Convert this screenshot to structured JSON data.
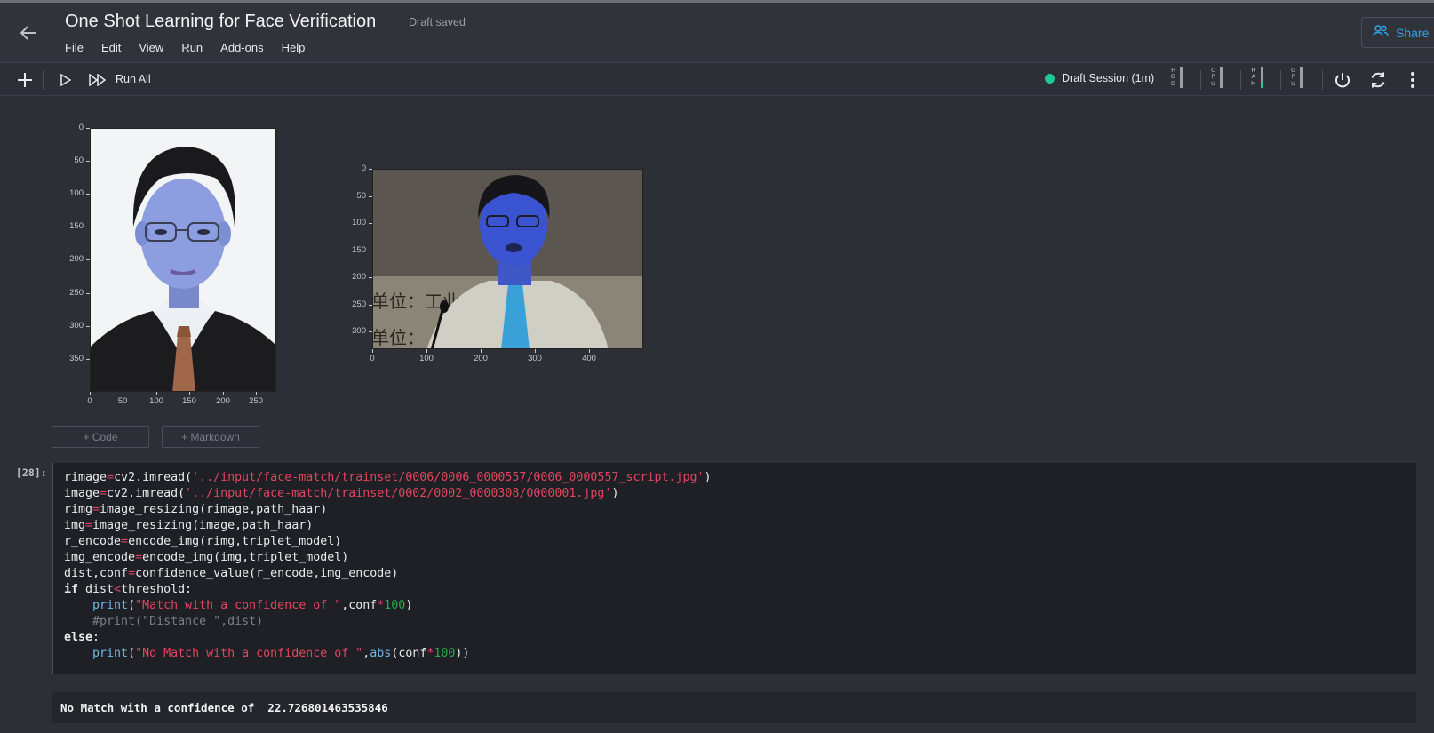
{
  "app": {
    "title": "One Shot Learning for Face Verification",
    "draft_status": "Draft saved",
    "menu": [
      "File",
      "Edit",
      "View",
      "Run",
      "Add-ons",
      "Help"
    ],
    "share_label": "Share"
  },
  "toolbar": {
    "run_all_label": "Run All",
    "session_label": "Draft Session (1m)",
    "session_color": "#20c997",
    "meters": [
      {
        "name": "HDD",
        "letters": [
          "H",
          "D",
          "D"
        ],
        "fill": 0.0
      },
      {
        "name": "CPU",
        "letters": [
          "C",
          "P",
          "U"
        ],
        "fill": 0.0
      },
      {
        "name": "RAM",
        "letters": [
          "R",
          "A",
          "M"
        ],
        "fill": 0.3
      },
      {
        "name": "GPU",
        "letters": [
          "G",
          "P",
          "U"
        ],
        "fill": 0.0
      }
    ]
  },
  "plots": [
    {
      "name": "reference-face-plot",
      "yticks": [
        "0",
        "50",
        "100",
        "150",
        "200",
        "250",
        "300",
        "350"
      ],
      "xticks": [
        "0",
        "50",
        "100",
        "150",
        "200",
        "250"
      ]
    },
    {
      "name": "test-face-plot",
      "yticks": [
        "0",
        "50",
        "100",
        "150",
        "200",
        "250",
        "300"
      ],
      "xticks": [
        "0",
        "100",
        "200",
        "300",
        "400"
      ]
    }
  ],
  "add_buttons": {
    "code": "+ Code",
    "markdown": "+ Markdown"
  },
  "cell": {
    "prompt": "[28]:",
    "code_lines": [
      "rimage=cv2.imread('../input/face-match/trainset/0006/0006_0000557/0006_0000557_script.jpg')",
      "image=cv2.imread('../input/face-match/trainset/0002/0002_0000308/0000001.jpg')",
      "rimg=image_resizing(rimage,path_haar)",
      "img=image_resizing(image,path_haar)",
      "r_encode=encode_img(rimg,triplet_model)",
      "img_encode=encode_img(img,triplet_model)",
      "dist,conf=confidence_value(r_encode,img_encode)",
      "if dist<threshold:",
      "    print(\"Match with a confidence of \",conf*100)",
      "    #print(\"Distance \",dist)",
      "else:",
      "    print(\"No Match with a confidence of \",abs(conf*100))"
    ],
    "output": "No Match with a confidence of  22.726801463535846"
  }
}
